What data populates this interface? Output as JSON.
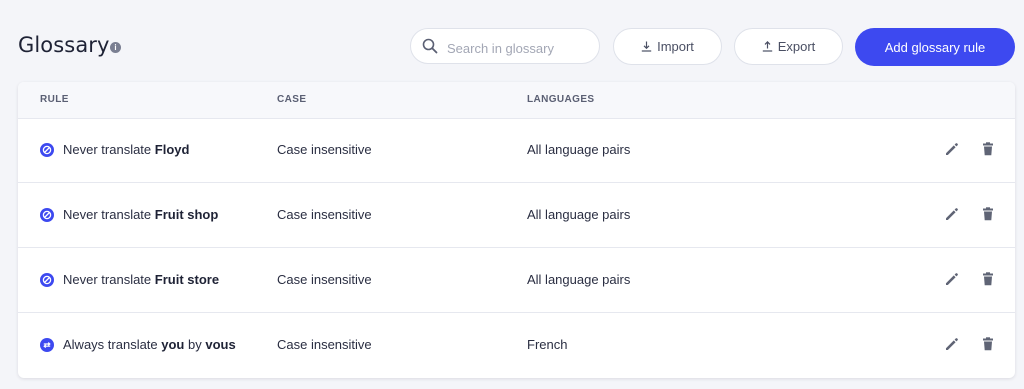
{
  "header": {
    "title": "Glossary",
    "info_icon": "info-icon",
    "search_placeholder": "Search in glossary",
    "import_label": "Import",
    "export_label": "Export",
    "add_label": "Add glossary rule",
    "accent_color": "#3d49f0"
  },
  "table": {
    "columns": {
      "rule": "RULE",
      "case": "CASE",
      "languages": "LANGUAGES"
    },
    "rows": [
      {
        "icon": "never-translate-icon",
        "prefix": "Never translate ",
        "term": "Floyd",
        "mid": "",
        "target": "",
        "case": "Case insensitive",
        "languages": "All language pairs"
      },
      {
        "icon": "never-translate-icon",
        "prefix": "Never translate ",
        "term": "Fruit shop",
        "mid": "",
        "target": "",
        "case": "Case insensitive",
        "languages": "All language pairs"
      },
      {
        "icon": "never-translate-icon",
        "prefix": "Never translate ",
        "term": "Fruit store",
        "mid": "",
        "target": "",
        "case": "Case insensitive",
        "languages": "All language pairs"
      },
      {
        "icon": "always-translate-icon",
        "prefix": "Always translate ",
        "term": "you",
        "mid": " by ",
        "target": "vous",
        "case": "Case insensitive",
        "languages": "French"
      }
    ]
  }
}
